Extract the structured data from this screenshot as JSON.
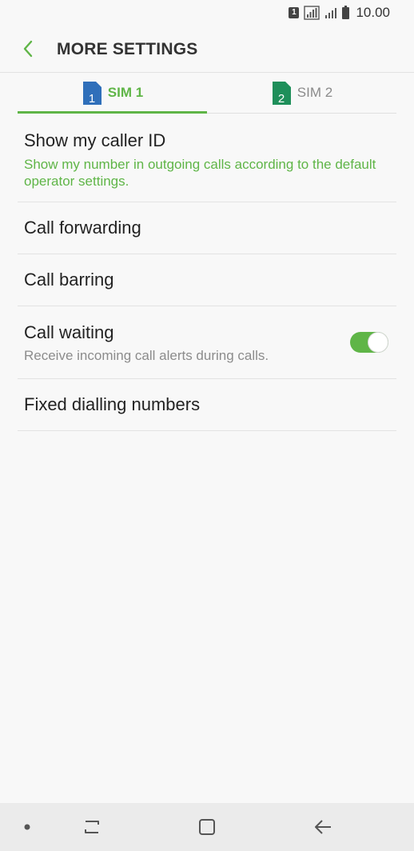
{
  "status_bar": {
    "sim_indicator": "1",
    "time": "10.00",
    "icons": [
      "sim-card-icon",
      "signal-icon",
      "signal-icon",
      "battery-icon"
    ]
  },
  "header": {
    "title": "MORE SETTINGS",
    "back_icon": "back-arrow-icon"
  },
  "tabs": [
    {
      "label": "SIM 1",
      "number": "1",
      "active": true,
      "color": "#2f6fba"
    },
    {
      "label": "SIM 2",
      "number": "2",
      "active": false,
      "color": "#1e8f5a"
    }
  ],
  "settings": {
    "caller_id": {
      "title": "Show my caller ID",
      "subtitle": "Show my number in outgoing calls according to the default operator settings."
    },
    "call_forwarding": {
      "title": "Call forwarding"
    },
    "call_barring": {
      "title": "Call barring"
    },
    "call_waiting": {
      "title": "Call waiting",
      "subtitle": "Receive incoming call alerts during calls.",
      "enabled": true
    },
    "fixed_dialling": {
      "title": "Fixed dialling numbers"
    }
  },
  "nav_bar": {
    "items": [
      "dot-icon",
      "recents-icon",
      "home-icon",
      "back-icon"
    ]
  },
  "colors": {
    "accent": "#5fb547",
    "background": "#f8f8f8",
    "nav_background": "#ebebeb"
  }
}
